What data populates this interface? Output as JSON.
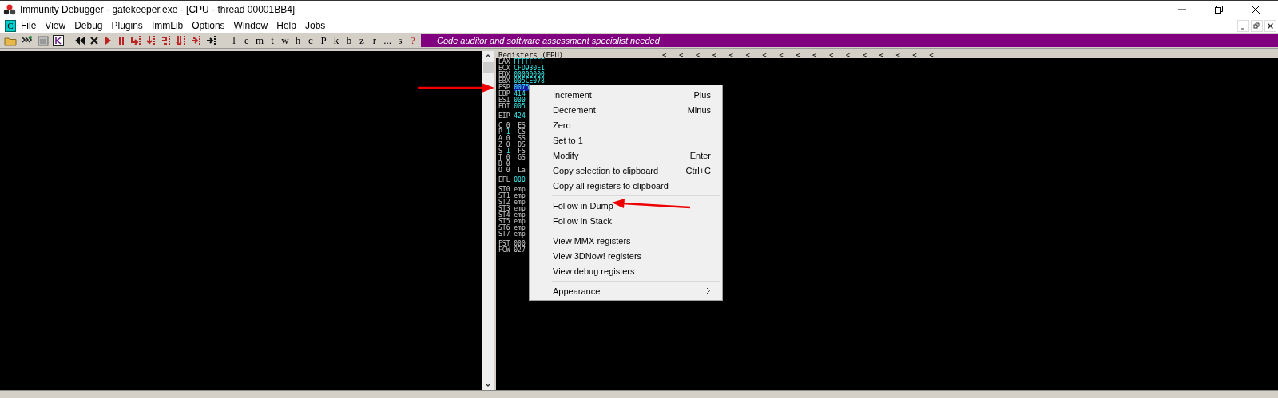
{
  "window": {
    "title": "Immunity Debugger - gatekeeper.exe - [CPU - thread 00001BB4]"
  },
  "child_window": {
    "badge": "C"
  },
  "menu": [
    "File",
    "View",
    "Debug",
    "Plugins",
    "ImmLib",
    "Options",
    "Window",
    "Help",
    "Jobs"
  ],
  "toolbar": {
    "letters": [
      "l",
      "e",
      "m",
      "t",
      "w",
      "h",
      "c",
      "P",
      "k",
      "b",
      "z",
      "r",
      "...",
      "s",
      "?"
    ],
    "banner": "Code auditor and software assessment specialist needed"
  },
  "registers": {
    "title": "Registers (FPU)",
    "arrows": [
      "<",
      "<",
      "<",
      "<",
      "<",
      "<",
      "<",
      "<",
      "<",
      "<",
      "<",
      "<",
      "<",
      "<",
      "<",
      "<",
      "<"
    ],
    "general": [
      {
        "name": "EAX",
        "value": "FFFFFFFF",
        "selected": false
      },
      {
        "name": "ECX",
        "value": "CFD930E1",
        "selected": false
      },
      {
        "name": "EDX",
        "value": "00000000",
        "selected": false
      },
      {
        "name": "EBX",
        "value": "005CE078",
        "selected": false
      },
      {
        "name": "ESP",
        "value": "0075",
        "selected": true
      },
      {
        "name": "EBP",
        "value": "414",
        "selected": false
      },
      {
        "name": "ESI",
        "value": "000",
        "selected": false
      },
      {
        "name": "EDI",
        "value": "005",
        "selected": false
      }
    ],
    "eip": {
      "name": "EIP",
      "value": "424"
    },
    "flags": [
      {
        "name": "C",
        "value": "0",
        "changed": false,
        "segment": "ES"
      },
      {
        "name": "P",
        "value": "1",
        "changed": true,
        "segment": "CS"
      },
      {
        "name": "A",
        "value": "0",
        "changed": false,
        "segment": "SS"
      },
      {
        "name": "Z",
        "value": "0",
        "changed": false,
        "segment": "DS"
      },
      {
        "name": "S",
        "value": "1",
        "changed": true,
        "segment": "FS"
      },
      {
        "name": "T",
        "value": "0",
        "changed": false,
        "segment": "GS"
      },
      {
        "name": "D",
        "value": "0",
        "changed": false
      },
      {
        "name": "O",
        "value": "0",
        "changed": false,
        "segment": "La"
      }
    ],
    "efl": {
      "name": "EFL",
      "value": "000"
    },
    "fpu": [
      {
        "name": "ST0",
        "value": "emp"
      },
      {
        "name": "ST1",
        "value": "emp"
      },
      {
        "name": "ST2",
        "value": "emp"
      },
      {
        "name": "ST3",
        "value": "emp"
      },
      {
        "name": "ST4",
        "value": "emp"
      },
      {
        "name": "ST5",
        "value": "emp"
      },
      {
        "name": "ST6",
        "value": "emp"
      },
      {
        "name": "ST7",
        "value": "emp"
      }
    ],
    "fpu_status": [
      {
        "name": "FST",
        "value": "000"
      },
      {
        "name": "FCW",
        "value": "027"
      }
    ]
  },
  "context_menu": [
    [
      {
        "label": "Increment",
        "shortcut": "Plus"
      },
      {
        "label": "Decrement",
        "shortcut": "Minus"
      },
      {
        "label": "Zero"
      },
      {
        "label": "Set to 1"
      },
      {
        "label": "Modify",
        "shortcut": "Enter"
      },
      {
        "label": "Copy selection to clipboard",
        "shortcut": "Ctrl+C"
      },
      {
        "label": "Copy all registers to clipboard"
      }
    ],
    [
      {
        "label": "Follow in Dump"
      },
      {
        "label": "Follow in Stack"
      }
    ],
    [
      {
        "label": "View MMX registers"
      },
      {
        "label": "View 3DNow! registers"
      },
      {
        "label": "View debug registers"
      }
    ],
    [
      {
        "label": "Appearance",
        "submenu": true
      }
    ]
  ]
}
